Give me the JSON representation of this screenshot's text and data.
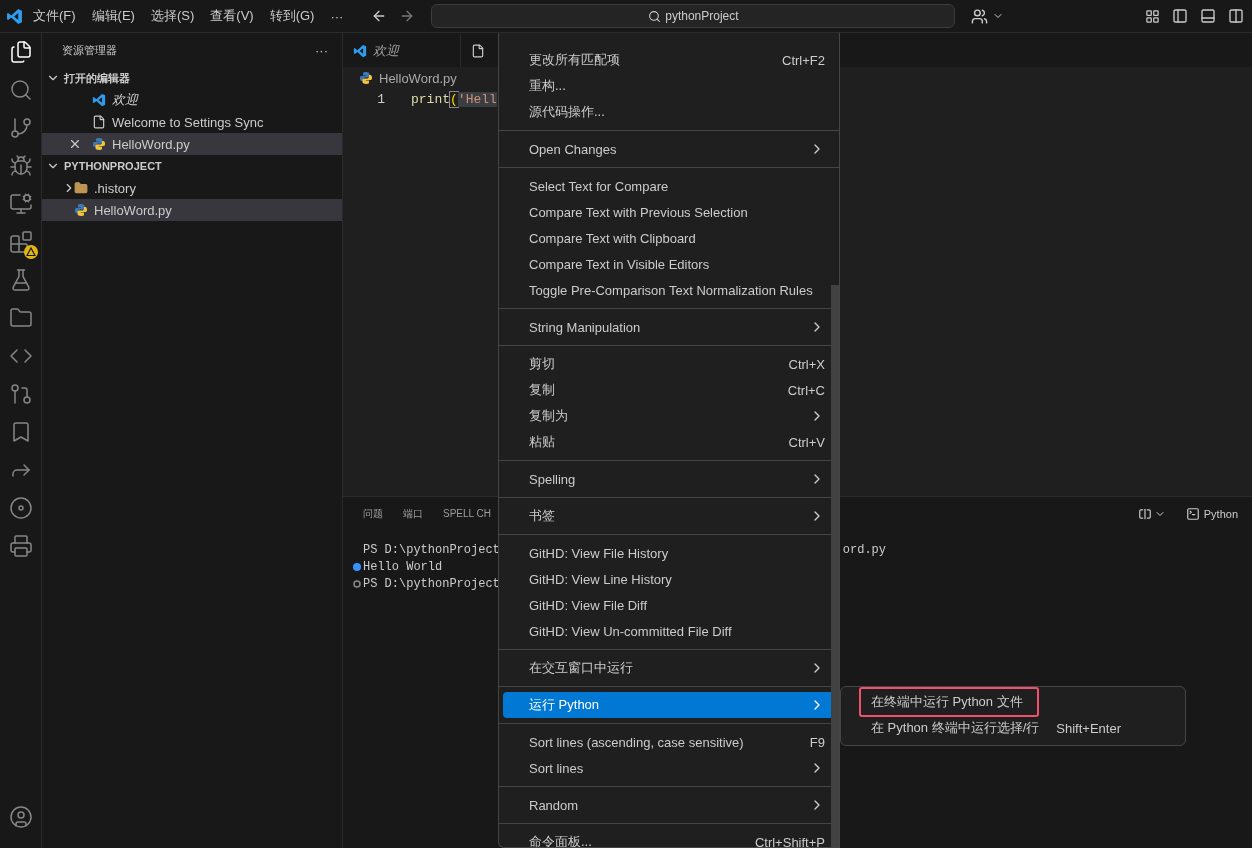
{
  "title_bar": {
    "menus": [
      "文件(F)",
      "编辑(E)",
      "选择(S)",
      "查看(V)",
      "转到(G)"
    ],
    "more": "···",
    "search": "pythonProject"
  },
  "activity_bar": [
    {
      "kind": "files",
      "selected": true,
      "warning": false
    },
    {
      "kind": "search",
      "selected": false,
      "warning": false
    },
    {
      "kind": "source-control",
      "selected": false,
      "warning": false
    },
    {
      "kind": "run",
      "selected": false,
      "warning": false
    },
    {
      "kind": "remote",
      "selected": false,
      "warning": false
    },
    {
      "kind": "extensions",
      "selected": false,
      "warning": true
    },
    {
      "kind": "testing",
      "selected": false,
      "warning": false
    },
    {
      "kind": "folder",
      "selected": false,
      "warning": false
    },
    {
      "kind": "code",
      "selected": false,
      "warning": false
    },
    {
      "kind": "git",
      "selected": false,
      "warning": false
    },
    {
      "kind": "bookmark",
      "selected": false,
      "warning": false
    },
    {
      "kind": "share",
      "selected": false,
      "warning": false
    },
    {
      "kind": "music",
      "selected": false,
      "warning": false
    },
    {
      "kind": "typewriter",
      "selected": false,
      "warning": false
    }
  ],
  "sidebar": {
    "title": "资源管理器",
    "more": "···",
    "sections": [
      {
        "title": "打开的编辑器",
        "expanded": true,
        "items": [
          {
            "label": "欢迎",
            "kind": "welcome",
            "preview": true,
            "selected": false
          },
          {
            "label": "Welcome to Settings Sync",
            "kind": "file",
            "preview": false,
            "selected": false
          },
          {
            "label": "HelloWord.py",
            "kind": "python",
            "preview": false,
            "selected": true
          }
        ]
      },
      {
        "title": "PYTHONPROJECT",
        "expanded": true,
        "items": [
          {
            "label": ".history",
            "kind": "folder",
            "preview": false,
            "selected": false
          },
          {
            "label": "HelloWord.py",
            "kind": "python",
            "preview": false,
            "selected": true
          }
        ]
      }
    ]
  },
  "editor": {
    "tabs": [
      {
        "label": "欢迎",
        "kind": "welcome",
        "preview": true,
        "selected": false
      },
      {
        "kind": "file",
        "selected": false
      }
    ],
    "breadcrumb": "HelloWord.py",
    "lines": [
      {
        "number": "1",
        "func": "print",
        "paren": "(",
        "string": "'Hell"
      }
    ]
  },
  "panel": {
    "tabs": [
      {
        "label": "问题",
        "selected": false
      },
      {
        "label": "端口",
        "selected": false
      },
      {
        "label": "SPELL CH",
        "selected": false
      }
    ],
    "terminal_name": "Python",
    "terminal": [
      {
        "text": "PS D:\\pythonProject",
        "kind": "command",
        "tail": "ord.py"
      },
      {
        "text": "Hello World",
        "kind": "output"
      },
      {
        "text": "PS D:\\pythonProject",
        "kind": "prompt"
      }
    ]
  },
  "context_menu": {
    "groups": [
      [
        {
          "label": "更改所有匹配项",
          "shortcut": "Ctrl+F2",
          "submenu": false,
          "selected": false
        },
        {
          "label": "重构...",
          "submenu": false,
          "selected": false
        },
        {
          "label": "源代码操作...",
          "submenu": false,
          "selected": false
        }
      ],
      [
        {
          "label": "Open Changes",
          "submenu": true,
          "selected": false
        }
      ],
      [
        {
          "label": "Select Text for Compare",
          "submenu": false,
          "selected": false
        },
        {
          "label": "Compare Text with Previous Selection",
          "submenu": false,
          "selected": false
        },
        {
          "label": "Compare Text with Clipboard",
          "submenu": false,
          "selected": false
        },
        {
          "label": "Compare Text in Visible Editors",
          "submenu": false,
          "selected": false
        },
        {
          "label": "Toggle Pre-Comparison Text Normalization Rules",
          "submenu": false,
          "selected": false
        }
      ],
      [
        {
          "label": "String Manipulation",
          "submenu": true,
          "selected": false
        }
      ],
      [
        {
          "label": "剪切",
          "shortcut": "Ctrl+X",
          "submenu": false,
          "selected": false
        },
        {
          "label": "复制",
          "shortcut": "Ctrl+C",
          "submenu": false,
          "selected": false
        },
        {
          "label": "复制为",
          "submenu": true,
          "selected": false
        },
        {
          "label": "粘贴",
          "shortcut": "Ctrl+V",
          "submenu": false,
          "selected": false
        }
      ],
      [
        {
          "label": "Spelling",
          "submenu": true,
          "selected": false
        }
      ],
      [
        {
          "label": "书签",
          "submenu": true,
          "selected": false
        }
      ],
      [
        {
          "label": "GitHD: View File History",
          "submenu": false,
          "selected": false
        },
        {
          "label": "GitHD: View Line History",
          "submenu": false,
          "selected": false
        },
        {
          "label": "GitHD: View File Diff",
          "submenu": false,
          "selected": false
        },
        {
          "label": "GitHD: View Un-committed File Diff",
          "submenu": false,
          "selected": false
        }
      ],
      [
        {
          "label": "在交互窗口中运行",
          "submenu": true,
          "selected": false
        }
      ],
      [
        {
          "label": "运行 Python",
          "submenu": true,
          "selected": true
        }
      ],
      [
        {
          "label": "Sort lines (ascending, case sensitive)",
          "shortcut": "F9",
          "submenu": false,
          "selected": false
        },
        {
          "label": "Sort lines",
          "submenu": true,
          "selected": false
        }
      ],
      [
        {
          "label": "Random",
          "submenu": true,
          "selected": false
        }
      ],
      [
        {
          "label": "命令面板...",
          "shortcut": "Ctrl+Shift+P",
          "submenu": false,
          "selected": false
        }
      ]
    ]
  },
  "submenu": {
    "items": [
      {
        "label": "在终端中运行 Python 文件",
        "highlighted": true
      },
      {
        "label": "在 Python 终端中运行选择/行",
        "shortcut": "Shift+Enter",
        "highlighted": false
      }
    ]
  }
}
